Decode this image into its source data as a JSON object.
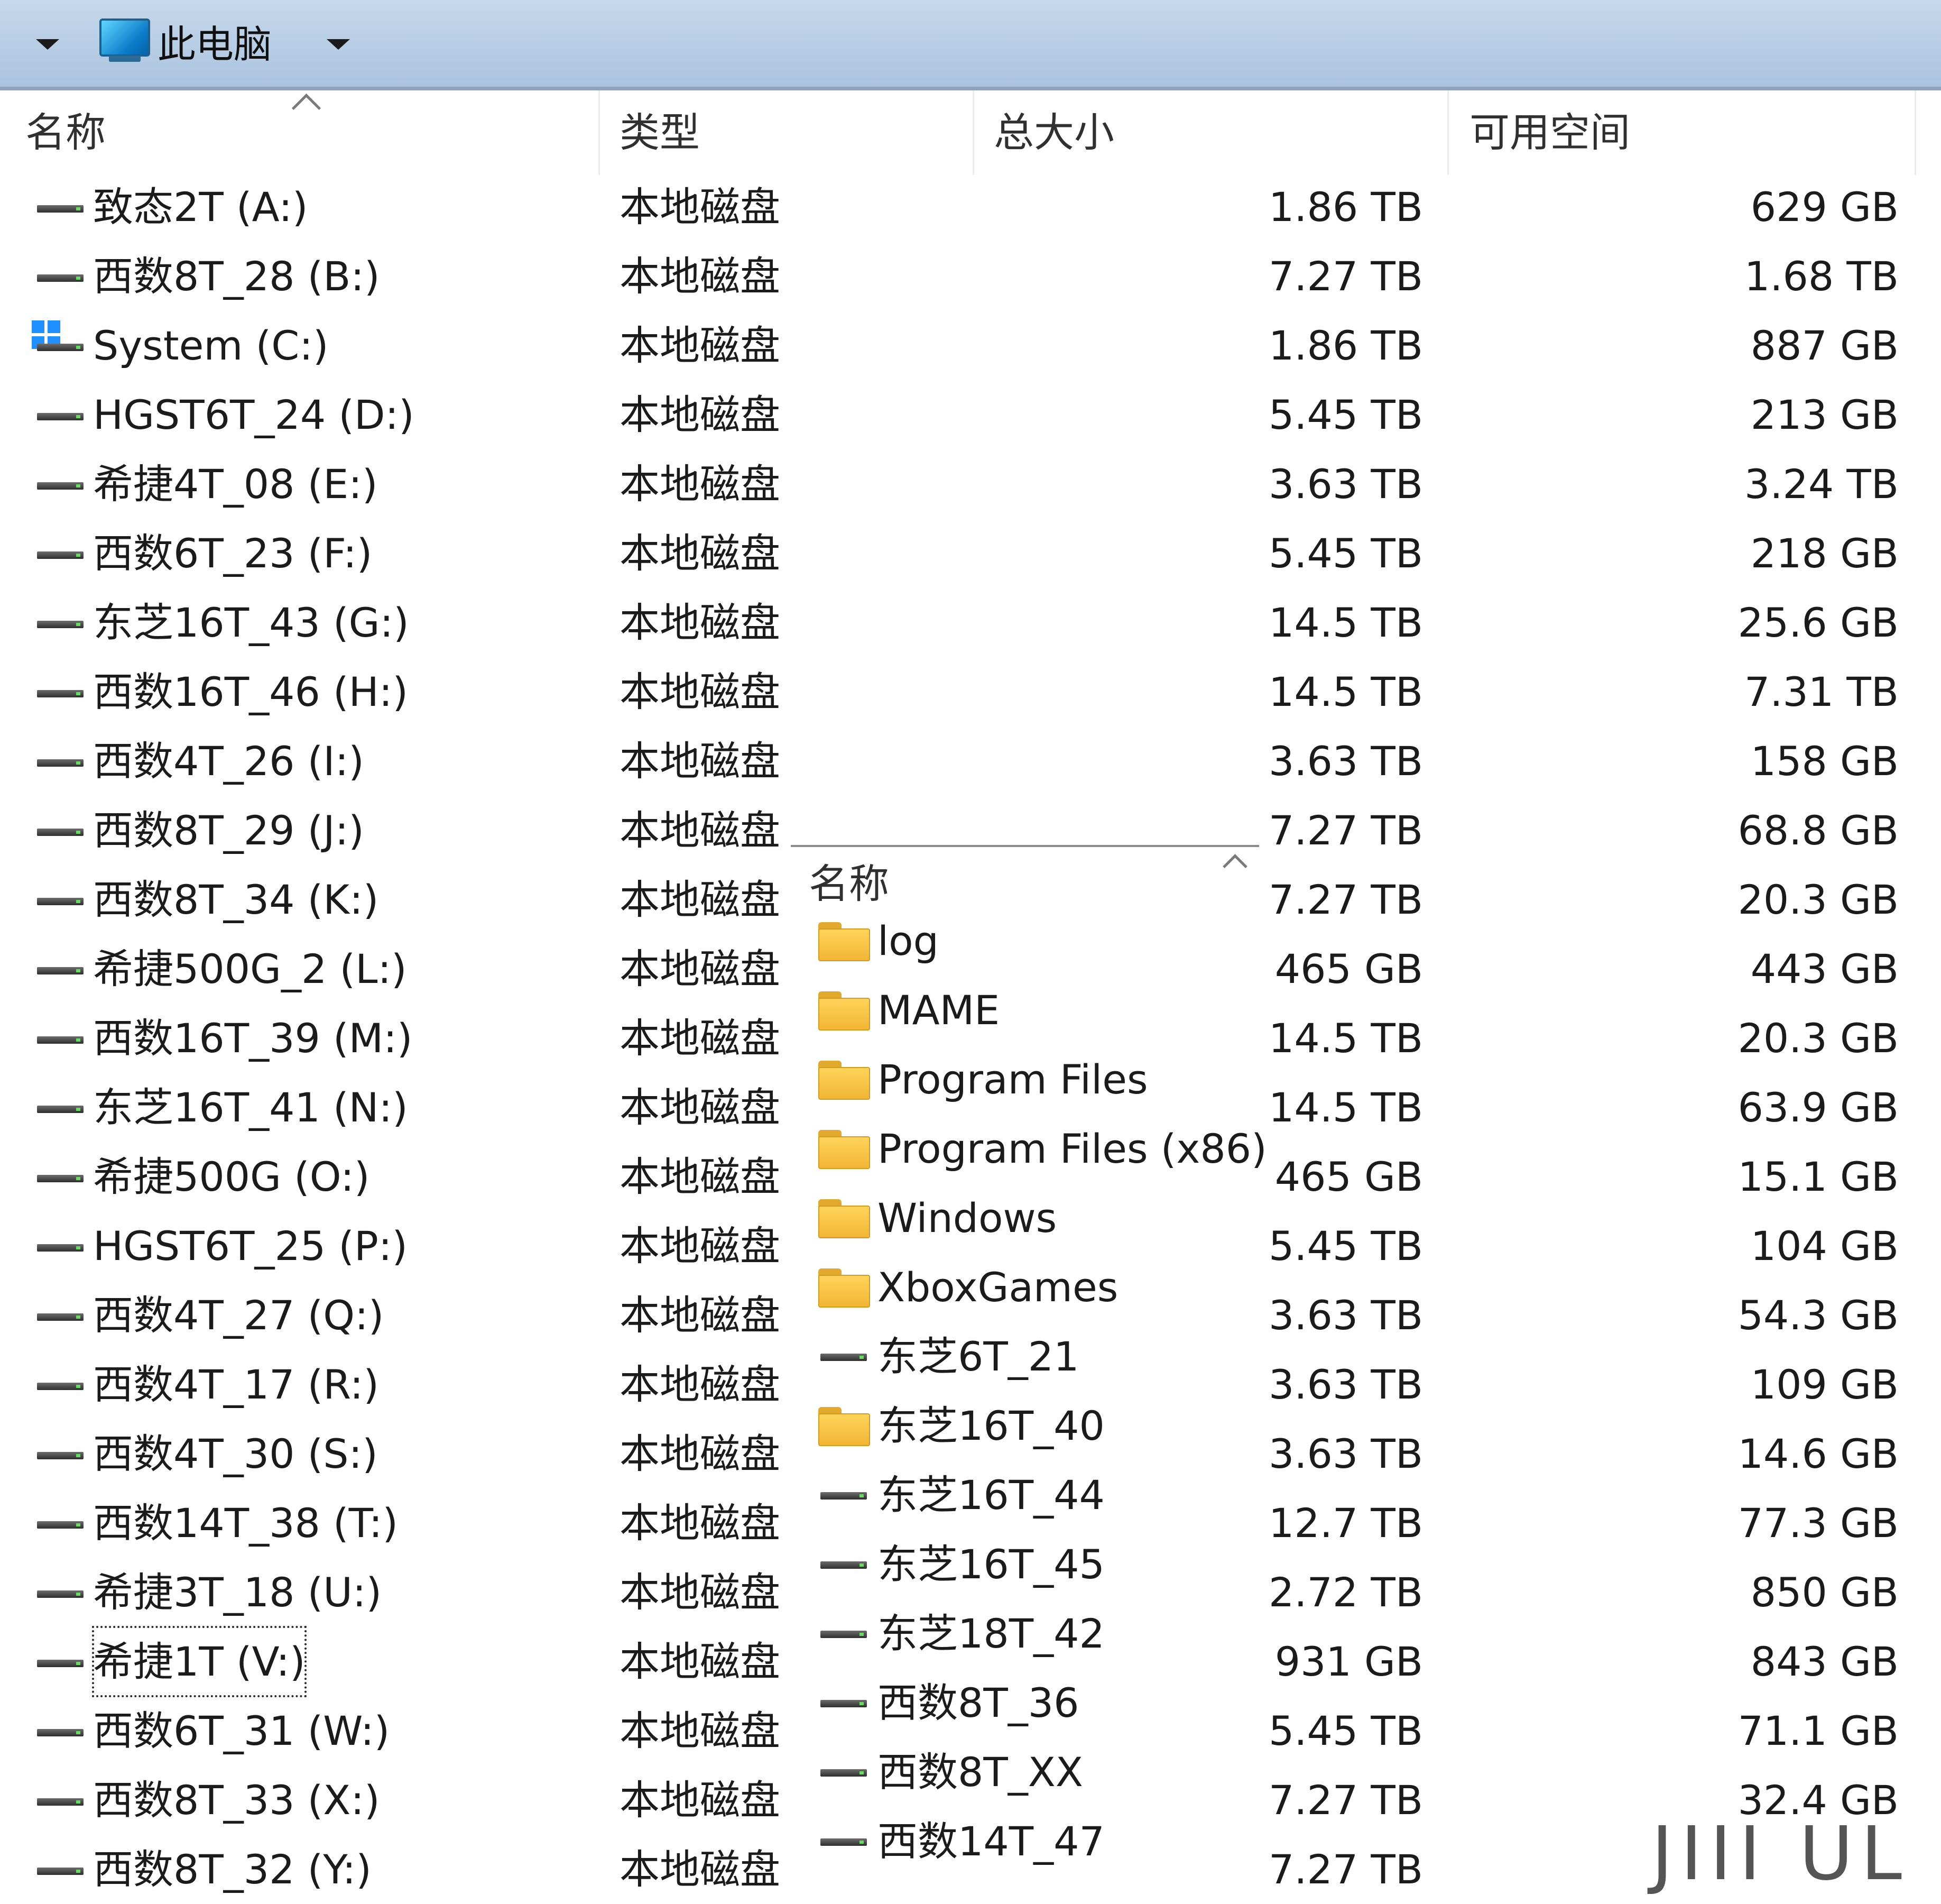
{
  "address_bar": {
    "location": "此电脑"
  },
  "columns": {
    "name": "名称",
    "type": "类型",
    "total": "总大小",
    "free": "可用空间"
  },
  "drives": [
    {
      "name": "致态2T (A:)",
      "type": "本地磁盘",
      "total": "1.86 TB",
      "free": "629 GB",
      "icon": "drive-icon"
    },
    {
      "name": "西数8T_28 (B:)",
      "type": "本地磁盘",
      "total": "7.27 TB",
      "free": "1.68 TB",
      "icon": "drive-icon"
    },
    {
      "name": "System (C:)",
      "type": "本地磁盘",
      "total": "1.86 TB",
      "free": "887 GB",
      "icon": "windows-drive-icon"
    },
    {
      "name": "HGST6T_24 (D:)",
      "type": "本地磁盘",
      "total": "5.45 TB",
      "free": "213 GB",
      "icon": "drive-icon"
    },
    {
      "name": "希捷4T_08 (E:)",
      "type": "本地磁盘",
      "total": "3.63 TB",
      "free": "3.24 TB",
      "icon": "drive-icon"
    },
    {
      "name": "西数6T_23 (F:)",
      "type": "本地磁盘",
      "total": "5.45 TB",
      "free": "218 GB",
      "icon": "drive-icon"
    },
    {
      "name": "东芝16T_43 (G:)",
      "type": "本地磁盘",
      "total": "14.5 TB",
      "free": "25.6 GB",
      "icon": "drive-icon"
    },
    {
      "name": "西数16T_46 (H:)",
      "type": "本地磁盘",
      "total": "14.5 TB",
      "free": "7.31 TB",
      "icon": "drive-icon"
    },
    {
      "name": "西数4T_26 (I:)",
      "type": "本地磁盘",
      "total": "3.63 TB",
      "free": "158 GB",
      "icon": "drive-icon"
    },
    {
      "name": "西数8T_29 (J:)",
      "type": "本地磁盘",
      "total": "7.27 TB",
      "free": "68.8 GB",
      "icon": "drive-icon"
    },
    {
      "name": "西数8T_34 (K:)",
      "type": "本地磁盘",
      "total": "7.27 TB",
      "free": "20.3 GB",
      "icon": "drive-icon"
    },
    {
      "name": "希捷500G_2 (L:)",
      "type": "本地磁盘",
      "total": "465 GB",
      "free": "443 GB",
      "icon": "drive-icon"
    },
    {
      "name": "西数16T_39 (M:)",
      "type": "本地磁盘",
      "total": "14.5 TB",
      "free": "20.3 GB",
      "icon": "drive-icon"
    },
    {
      "name": "东芝16T_41 (N:)",
      "type": "本地磁盘",
      "total": "14.5 TB",
      "free": "63.9 GB",
      "icon": "drive-icon"
    },
    {
      "name": "希捷500G (O:)",
      "type": "本地磁盘",
      "total": "465 GB",
      "free": "15.1 GB",
      "icon": "drive-icon"
    },
    {
      "name": "HGST6T_25 (P:)",
      "type": "本地磁盘",
      "total": "5.45 TB",
      "free": "104 GB",
      "icon": "drive-icon"
    },
    {
      "name": "西数4T_27 (Q:)",
      "type": "本地磁盘",
      "total": "3.63 TB",
      "free": "54.3 GB",
      "icon": "drive-icon"
    },
    {
      "name": "西数4T_17 (R:)",
      "type": "本地磁盘",
      "total": "3.63 TB",
      "free": "109 GB",
      "icon": "drive-icon"
    },
    {
      "name": "西数4T_30 (S:)",
      "type": "本地磁盘",
      "total": "3.63 TB",
      "free": "14.6 GB",
      "icon": "drive-icon"
    },
    {
      "name": "西数14T_38 (T:)",
      "type": "本地磁盘",
      "total": "12.7 TB",
      "free": "77.3 GB",
      "icon": "drive-icon"
    },
    {
      "name": "希捷3T_18 (U:)",
      "type": "本地磁盘",
      "total": "2.72 TB",
      "free": "850 GB",
      "icon": "drive-icon"
    },
    {
      "name": "希捷1T (V:)",
      "type": "本地磁盘",
      "total": "931 GB",
      "free": "843 GB",
      "icon": "drive-icon",
      "focused": true
    },
    {
      "name": "西数6T_31 (W:)",
      "type": "本地磁盘",
      "total": "5.45 TB",
      "free": "71.1 GB",
      "icon": "drive-icon"
    },
    {
      "name": "西数8T_33 (X:)",
      "type": "本地磁盘",
      "total": "7.27 TB",
      "free": "32.4 GB",
      "icon": "drive-icon"
    },
    {
      "name": "西数8T_32 (Y:)",
      "type": "本地磁盘",
      "total": "7.27 TB",
      "free": "",
      "icon": "drive-icon"
    }
  ],
  "overlay_pane": {
    "header": "名称",
    "items": [
      {
        "name": "log",
        "icon": "folder-icon"
      },
      {
        "name": "MAME",
        "icon": "folder-icon"
      },
      {
        "name": "Program Files",
        "icon": "folder-icon"
      },
      {
        "name": "Program Files (x86)",
        "icon": "folder-icon"
      },
      {
        "name": "Windows",
        "icon": "folder-icon"
      },
      {
        "name": "XboxGames",
        "icon": "folder-icon"
      },
      {
        "name": "东芝6T_21",
        "icon": "drive-icon"
      },
      {
        "name": "东芝16T_40",
        "icon": "folder-icon"
      },
      {
        "name": "东芝16T_44",
        "icon": "drive-icon"
      },
      {
        "name": "东芝16T_45",
        "icon": "drive-icon"
      },
      {
        "name": "东芝18T_42",
        "icon": "drive-icon"
      },
      {
        "name": "西数8T_36",
        "icon": "drive-icon"
      },
      {
        "name": "西数8T_XX",
        "icon": "drive-icon"
      },
      {
        "name": "西数14T_47",
        "icon": "drive-icon"
      }
    ]
  },
  "watermark": "JIII UL",
  "colors": {
    "address_bar": "#b7cde5",
    "folder": "#f5c13e",
    "drive_led": "#63e05a",
    "windows_logo": "#1e90ff"
  }
}
